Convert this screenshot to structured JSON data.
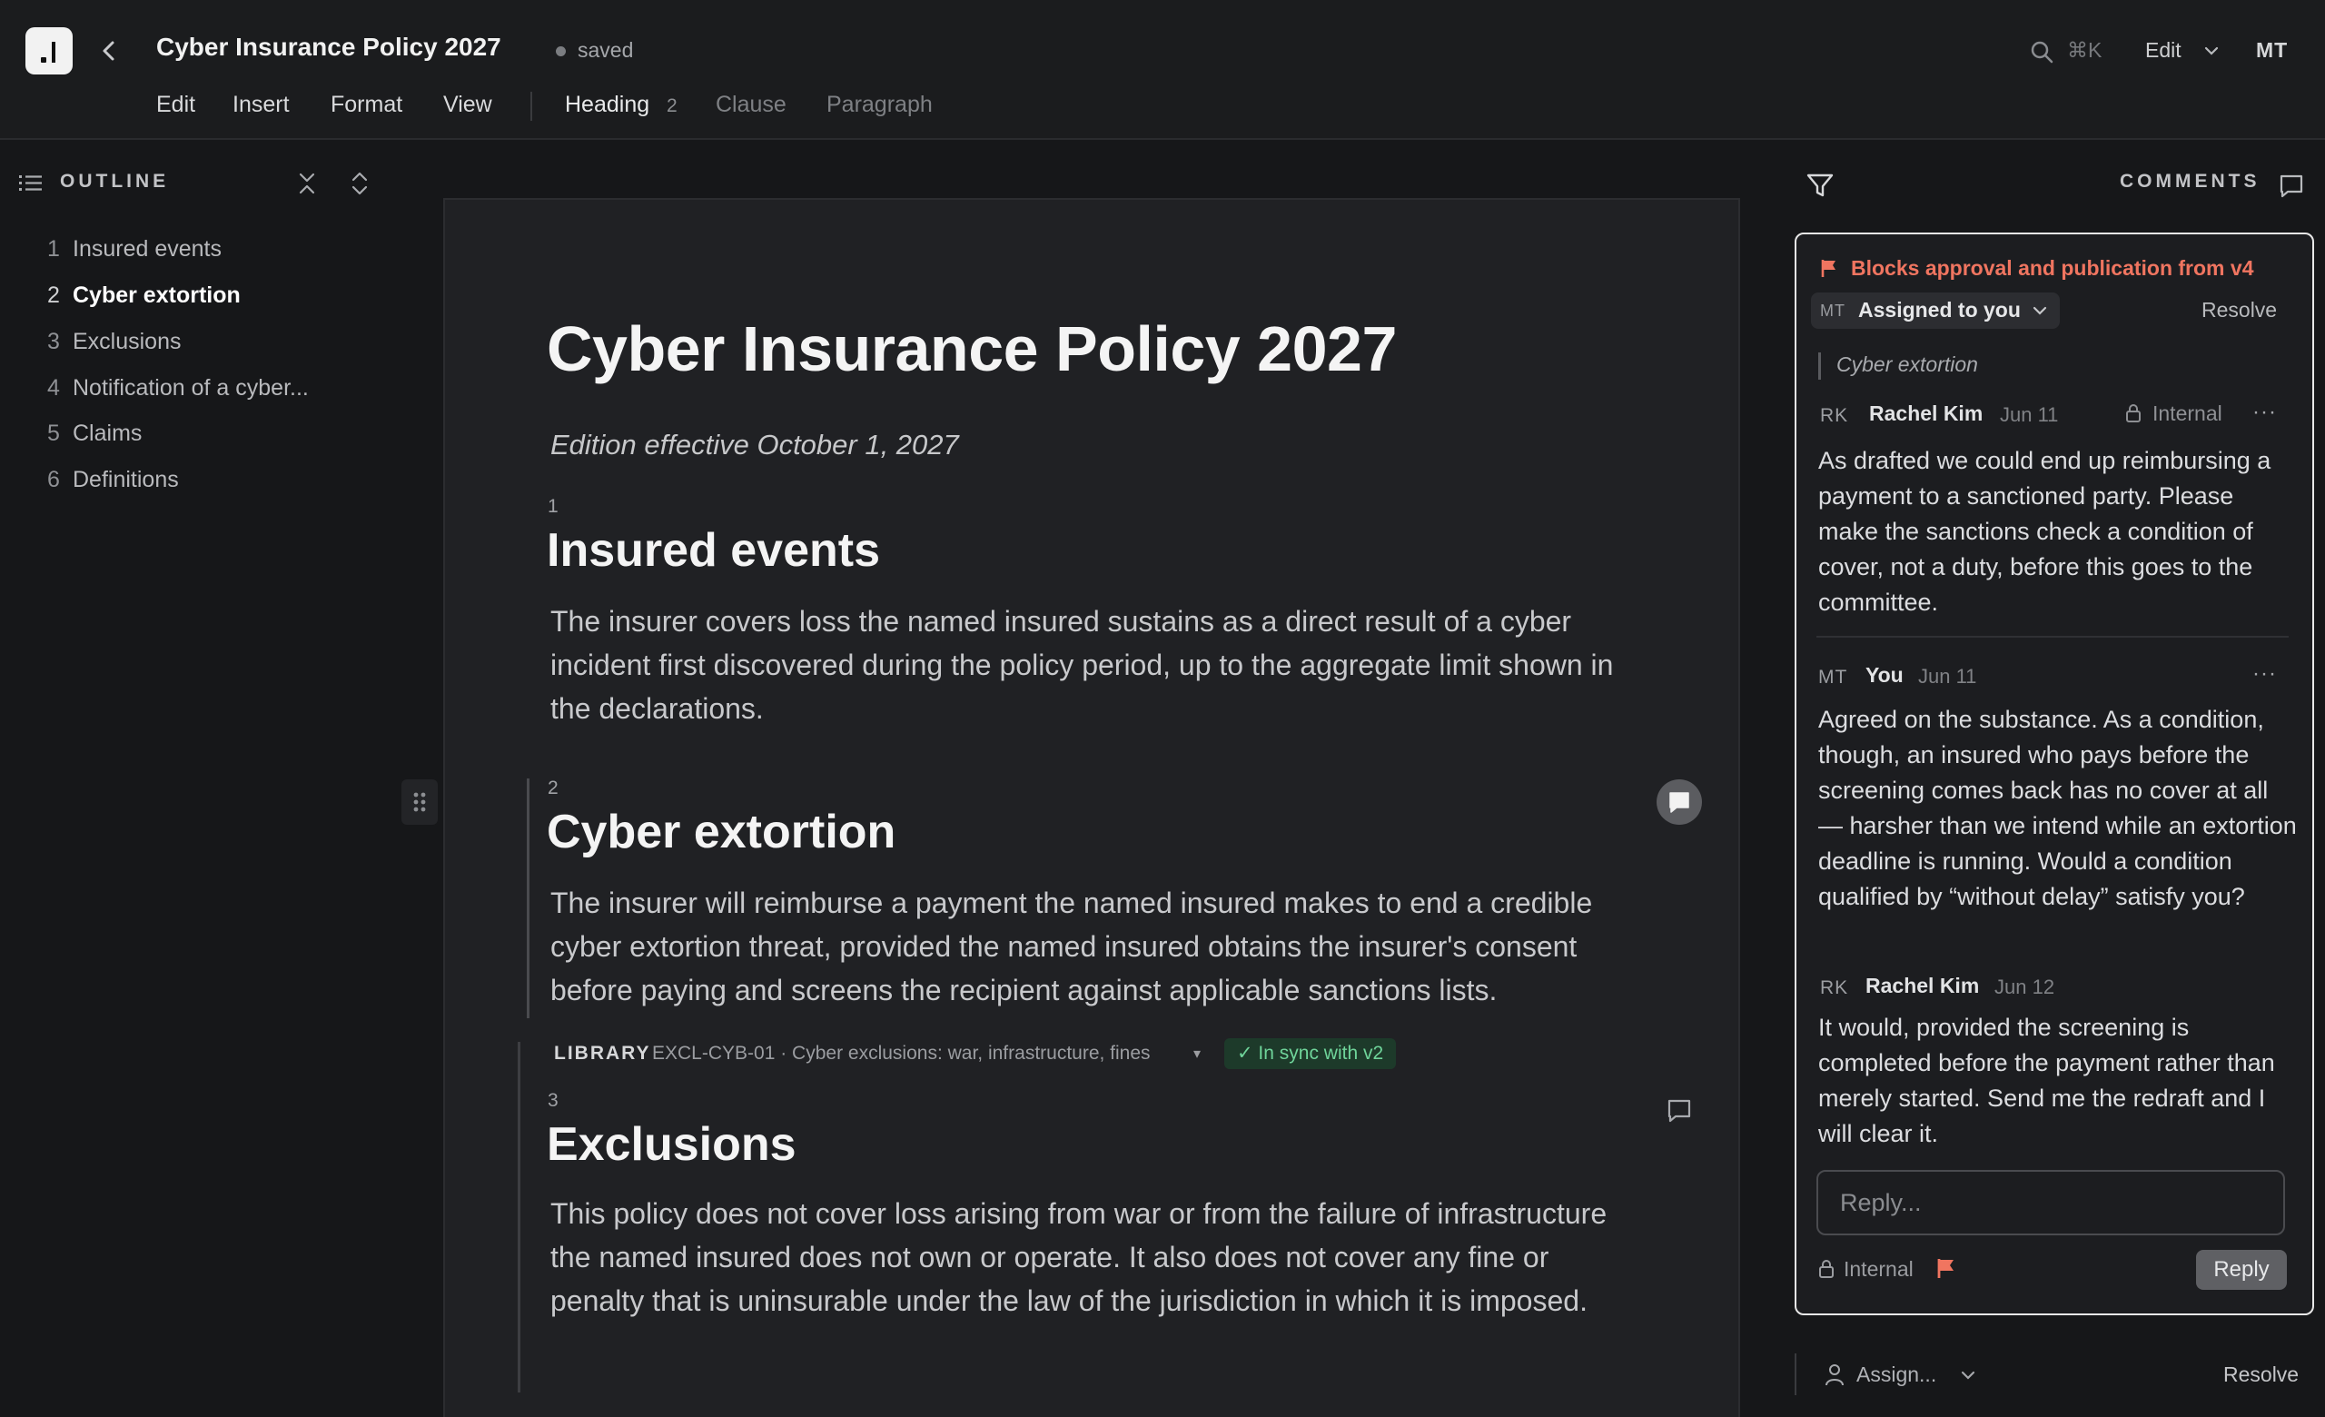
{
  "header": {
    "title": "Cyber Insurance Policy 2027",
    "save_status": "saved",
    "search_shortcut": "⌘K",
    "mode": "Edit",
    "user_initials": "MT"
  },
  "menu": {
    "items": [
      "Edit",
      "Insert",
      "Format",
      "View"
    ],
    "block_type": "Heading",
    "heading_level": "2",
    "clause": "Clause",
    "paragraph": "Paragraph"
  },
  "outline": {
    "label": "OUTLINE",
    "items": [
      {
        "num": "1",
        "label": "Insured events"
      },
      {
        "num": "2",
        "label": "Cyber extortion",
        "active": true
      },
      {
        "num": "3",
        "label": "Exclusions"
      },
      {
        "num": "4",
        "label": "Notification of a cyber..."
      },
      {
        "num": "5",
        "label": "Claims"
      },
      {
        "num": "6",
        "label": "Definitions"
      }
    ]
  },
  "document": {
    "title": "Cyber Insurance Policy 2027",
    "subtitle": "Edition effective October 1, 2027",
    "sections": [
      {
        "num": "1",
        "title": "Insured events",
        "body": "The insurer covers loss the named insured sustains as a direct result of a cyber incident first discovered during the policy period, up to the aggregate limit shown in the declarations."
      },
      {
        "num": "2",
        "title": "Cyber extortion",
        "body": "The insurer will reimburse a payment the named insured makes to end a credible cyber extortion threat, provided the named insured obtains the insurer's consent before paying and screens the recipient against applicable sanctions lists."
      },
      {
        "num": "3",
        "title": "Exclusions",
        "body": "This policy does not cover loss arising from war or from the failure of infrastructure the named insured does not own or operate. It also does not cover any fine or penalty that is uninsurable under the law of the jurisdiction in which it is imposed."
      }
    ],
    "library": {
      "label": "LIBRARY",
      "ref": "EXCL-CYB-01 · Cyber exclusions: war, infrastructure, fines",
      "caret": "▾",
      "status": "✓ In sync with v2"
    }
  },
  "comments": {
    "label": "COMMENTS",
    "thread": {
      "flag_text": "Blocks approval and publication from v4",
      "assignee_initials": "MT",
      "assigned_label": "Assigned to you",
      "resolve_label": "Resolve",
      "quote": "Cyber extortion",
      "items": [
        {
          "initials": "RK",
          "author": "Rachel Kim",
          "date": "Jun 11",
          "visibility": "Internal",
          "more": "···",
          "body": "As drafted we could end up reimbursing a payment to a sanctioned party. Please make the sanctions check a condition of cover, not a duty, before this goes to the committee."
        },
        {
          "initials": "MT",
          "author": "You",
          "date": "Jun 11",
          "more": "···",
          "body": "Agreed on the substance. As a condition, though, an insured who pays before the screening comes back has no cover at all — harsher than we intend while an extortion deadline is running. Would a condition qualified by “without delay” satisfy you?"
        },
        {
          "initials": "RK",
          "author": "Rachel Kim",
          "date": "Jun 12",
          "body": "It would, provided the screening is completed before the payment rather than merely started. Send me the redraft and I will clear it."
        }
      ],
      "reply_placeholder": "Reply...",
      "reply_visibility": "Internal",
      "reply_button": "Reply"
    },
    "next_thread": {
      "assign_label": "Assign...",
      "resolve_label": "Resolve"
    }
  },
  "colors": {
    "background": "#161719",
    "page": "#202124",
    "flag": "#f07560",
    "sync_badge_text": "#6fd49a",
    "active_thread_border": "#e8e8e8"
  },
  "icons": [
    "app-logo-icon",
    "back-icon",
    "search-icon",
    "chevron-down-icon",
    "outline-list-icon",
    "collapse-all-icon",
    "expand-all-icon",
    "drag-handle-icon",
    "comment-icon",
    "filter-icon",
    "comments-panel-icon",
    "flag-icon",
    "lock-icon",
    "more-icon",
    "person-icon"
  ]
}
